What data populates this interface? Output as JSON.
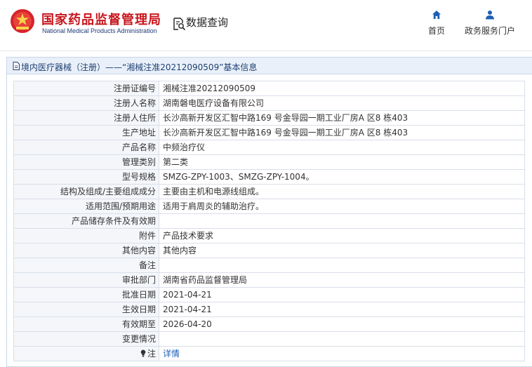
{
  "header": {
    "brand_cn": "国家药品监督管理局",
    "brand_en": "National Medical Products Administration",
    "query_title": "数据查询",
    "nav": {
      "home": "首页",
      "portal": "政务服务门户"
    }
  },
  "panel": {
    "title": "境内医疗器械（注册）——“湘械注准20212090509”基本信息"
  },
  "rows": [
    {
      "label": "注册证编号",
      "value": "湘械注准20212090509"
    },
    {
      "label": "注册人名称",
      "value": "湖南磐电医疗设备有限公司"
    },
    {
      "label": "注册人住所",
      "value": "长沙高新开发区汇智中路169 号金导园一期工业厂房A 区8 栋403"
    },
    {
      "label": "生产地址",
      "value": "长沙高新开发区汇智中路169 号金导园一期工业厂房A 区8 栋403"
    },
    {
      "label": "产品名称",
      "value": "中频治疗仪"
    },
    {
      "label": "管理类别",
      "value": "第二类"
    },
    {
      "label": "型号规格",
      "value": "SMZG-ZPY-1003、SMZG-ZPY-1004。"
    },
    {
      "label": "结构及组成/主要组成成分",
      "value": "主要由主机和电源线组成。"
    },
    {
      "label": "适用范围/预期用途",
      "value": "适用于肩周炎的辅助治疗。"
    },
    {
      "label": "产品储存条件及有效期",
      "value": ""
    },
    {
      "label": "附件",
      "value": "产品技术要求"
    },
    {
      "label": "其他内容",
      "value": "其他内容"
    },
    {
      "label": "备注",
      "value": ""
    },
    {
      "label": "审批部门",
      "value": "湖南省药品监督管理局"
    },
    {
      "label": "批准日期",
      "value": "2021-04-21"
    },
    {
      "label": "生效日期",
      "value": "2021-04-21"
    },
    {
      "label": "有效期至",
      "value": "2026-04-20"
    },
    {
      "label": "变更情况",
      "value": ""
    },
    {
      "label": "注",
      "value": "详情",
      "is_link": true
    }
  ],
  "colors": {
    "brand_red": "#c8161d",
    "brand_blue": "#1e3a78",
    "panel_header_bg": "#e9f0f9",
    "link": "#1d5fb4"
  },
  "icons": {
    "logo": "national-emblem-icon",
    "query": "document-search-icon",
    "home": "home-icon",
    "portal": "user-icon",
    "panel": "document-icon",
    "note": "lightbulb-icon"
  }
}
